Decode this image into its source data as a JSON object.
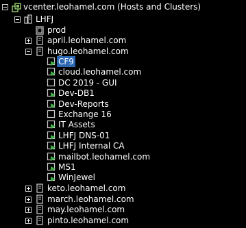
{
  "tree": {
    "root": {
      "label": "vcenter.leohamel.com (Hosts and Clusters)",
      "icon": "vcenter-icon"
    },
    "datacenter": {
      "label": "LHFJ",
      "icon": "datacenter-icon"
    },
    "cluster": {
      "label": "prod",
      "icon": "cluster-icon"
    },
    "hosts": [
      {
        "label": "april.leohamel.com",
        "expanded": false
      },
      {
        "label": "hugo.leohamel.com",
        "expanded": true
      },
      {
        "label": "keto.leohamel.com",
        "expanded": false
      },
      {
        "label": "march.leohamel.com",
        "expanded": false
      },
      {
        "label": "may.leohamel.com",
        "expanded": false
      },
      {
        "label": "pinto.leohamel.com",
        "expanded": false
      }
    ],
    "vms": [
      {
        "label": "CF9",
        "powered_on": true,
        "selected": true
      },
      {
        "label": "cloud.leohamel.com",
        "powered_on": true,
        "selected": false
      },
      {
        "label": "DC 2019 - GUI",
        "powered_on": false,
        "selected": false
      },
      {
        "label": "Dev-DB1",
        "powered_on": true,
        "selected": false
      },
      {
        "label": "Dev-Reports",
        "powered_on": true,
        "selected": false
      },
      {
        "label": "Exchange 16",
        "powered_on": false,
        "selected": false
      },
      {
        "label": "IT Assets",
        "powered_on": true,
        "selected": false
      },
      {
        "label": "LHFJ DNS-01",
        "powered_on": true,
        "selected": false
      },
      {
        "label": "LHFJ Internal CA",
        "powered_on": true,
        "selected": false
      },
      {
        "label": "mailbot.leohamel.com",
        "powered_on": true,
        "selected": false
      },
      {
        "label": "MS1",
        "powered_on": true,
        "selected": false
      },
      {
        "label": "WinJewel",
        "powered_on": true,
        "selected": false
      }
    ]
  },
  "colors": {
    "background": "#000000",
    "selection": "#2b67b2",
    "power_on_green": "#3cb043",
    "vcenter_green": "#6aa84f"
  }
}
